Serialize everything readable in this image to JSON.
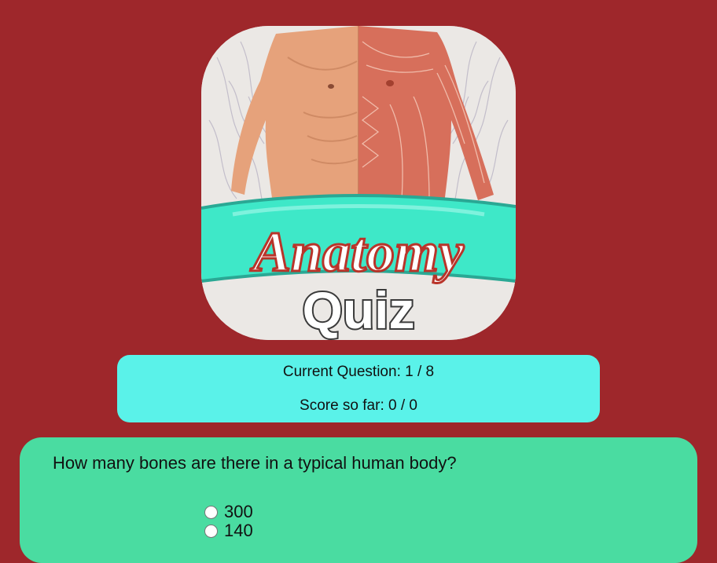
{
  "logo": {
    "title_word": "Anatomy",
    "subtitle_word": "Quiz"
  },
  "status": {
    "current_question": "Current Question: 1 / 8",
    "score": "Score so far: 0 / 0"
  },
  "question": {
    "text": "How many bones are there in a typical human body?",
    "options": [
      {
        "label": "300",
        "selected": false
      },
      {
        "label": "140",
        "selected": false
      }
    ]
  },
  "colors": {
    "background": "#9e272b",
    "status_box": "#5af2e9",
    "question_card": "#4adca1",
    "logo_banner": "#3ee8c8",
    "muscle": "#d9705c",
    "skin": "#e8a27a"
  }
}
